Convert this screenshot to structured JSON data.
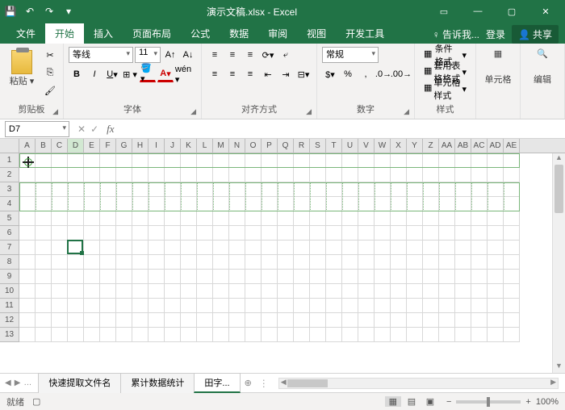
{
  "title": "演示文稿.xlsx - Excel",
  "tabs": [
    "文件",
    "开始",
    "插入",
    "页面布局",
    "公式",
    "数据",
    "审阅",
    "视图",
    "开发工具"
  ],
  "tell_me": "告诉我...",
  "login": "登录",
  "share": "共享",
  "groups": {
    "clipboard": {
      "label": "剪贴板",
      "paste": "粘贴"
    },
    "font": {
      "label": "字体",
      "name": "等线",
      "size": "11"
    },
    "align": {
      "label": "对齐方式"
    },
    "number": {
      "label": "数字",
      "format": "常规"
    },
    "styles": {
      "label": "样式",
      "cond": "条件格式",
      "table": "套用表格格式",
      "cell": "单元格样式"
    },
    "cells": {
      "label": "单元格"
    },
    "editing": {
      "label": "编辑"
    }
  },
  "namebox": "D7",
  "columns": [
    "A",
    "B",
    "C",
    "D",
    "E",
    "F",
    "G",
    "H",
    "I",
    "J",
    "K",
    "L",
    "M",
    "N",
    "O",
    "P",
    "Q",
    "R",
    "S",
    "T",
    "U",
    "V",
    "W",
    "X",
    "Y",
    "Z",
    "AA",
    "AB",
    "AC",
    "AD",
    "AE"
  ],
  "rows": [
    1,
    2,
    3,
    4,
    5,
    6,
    7,
    8,
    9,
    10,
    11,
    12,
    13
  ],
  "active_cell": {
    "col": 3,
    "row": 6
  },
  "sheets": [
    "快速提取文件名",
    "累计数据统计",
    "田字..."
  ],
  "active_sheet": 2,
  "status": "就绪",
  "zoom": "100%"
}
